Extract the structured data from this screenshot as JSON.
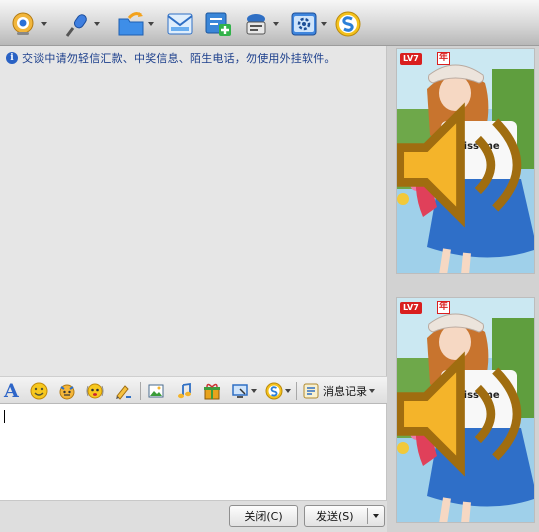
{
  "notice": {
    "icon": "info-icon",
    "text": "交谈中请勿轻信汇款、中奖信息、陌生电话，勿使用外挂软件。"
  },
  "top_toolbar": {
    "icons": [
      "webcam-icon",
      "microphone-icon",
      "send-file-icon",
      "mail-icon",
      "add-note-icon",
      "contact-card-icon",
      "app-box-icon",
      "soso-icon"
    ]
  },
  "input_toolbar": {
    "font_label": "A",
    "icons": [
      "smiley-icon",
      "magic-face-icon",
      "shake-icon",
      "scribble-icon",
      "image-icon",
      "music-icon",
      "gift-icon",
      "screenshot-icon",
      "soso-icon"
    ],
    "history_label": "消息记录"
  },
  "buttons": {
    "close_label": "关闭(C)",
    "send_label": "发送(S)"
  },
  "side_panel": {
    "level_badge": "LV7",
    "year_badge": "年",
    "photo_text": "kiss me"
  },
  "colors": {
    "toolbar_top": "#f7f7f7",
    "toolbar_bottom": "#b8b8b8",
    "chat_bg": "#e6e6e6",
    "notice_text": "#1c3f8c",
    "accent_blue": "#2f66c8",
    "badge_red": "#d91f1f"
  }
}
